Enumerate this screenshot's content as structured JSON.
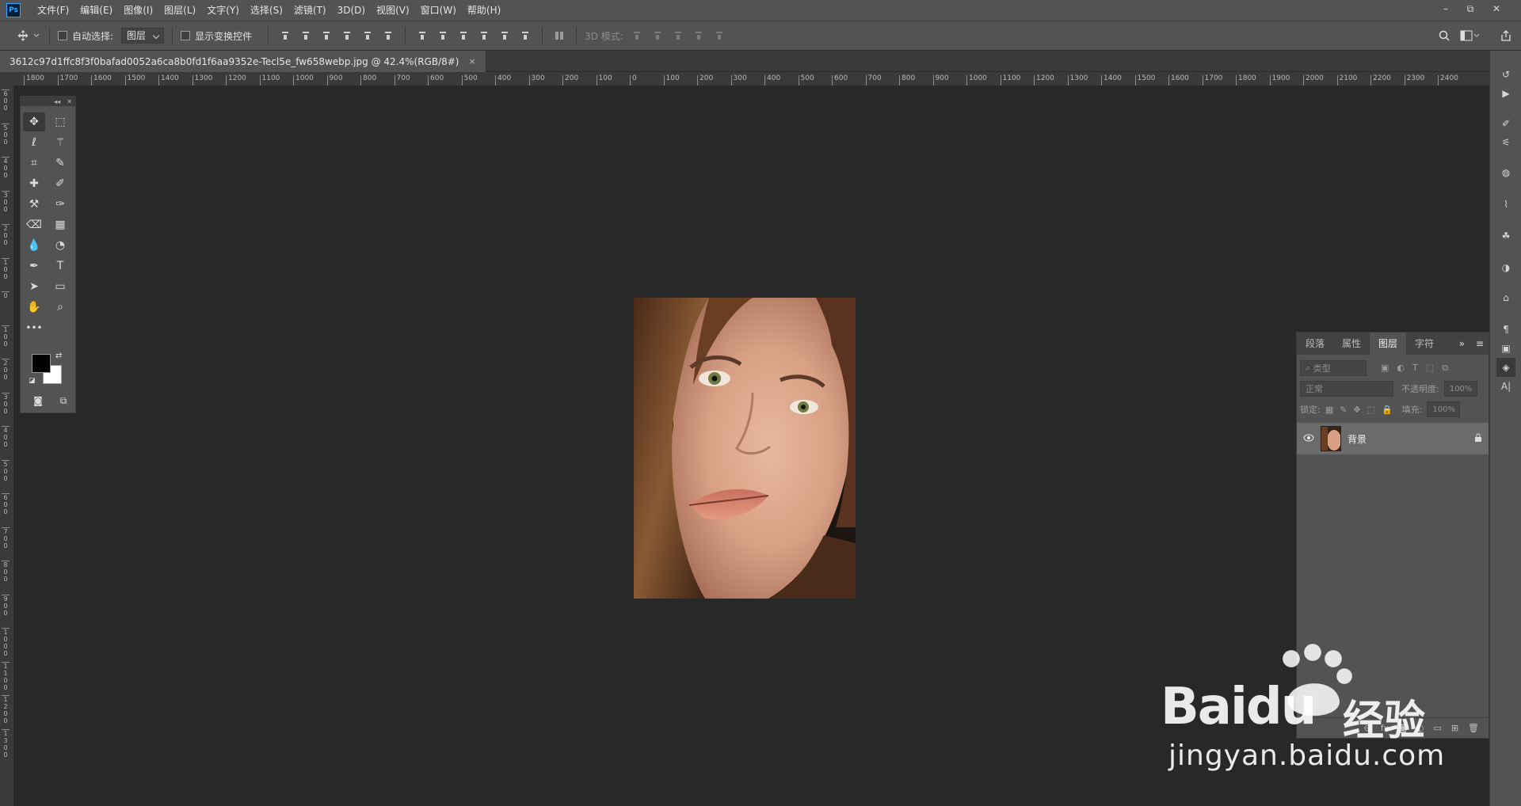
{
  "app": {
    "logo": "Ps"
  },
  "menu": [
    "文件(F)",
    "编辑(E)",
    "图像(I)",
    "图层(L)",
    "文字(Y)",
    "选择(S)",
    "滤镜(T)",
    "3D(D)",
    "视图(V)",
    "窗口(W)",
    "帮助(H)"
  ],
  "window_controls": {
    "minimize": "–",
    "restore": "⧉",
    "close": "✕"
  },
  "options": {
    "auto_select_label": "自动选择:",
    "auto_select_target": "图层",
    "show_transform_label": "显示变换控件",
    "mode_3d_label": "3D 模式:"
  },
  "document_tab": {
    "title": "3612c97d1ffc8f3f0bafad0052a6ca8b0fd1f6aa9352e-Tecl5e_fw658webp.jpg @ 42.4%(RGB/8#)",
    "close": "×"
  },
  "ruler": {
    "horizontal": [
      "1800",
      "1700",
      "1600",
      "1500",
      "1400",
      "1300",
      "1200",
      "1100",
      "1000",
      "900",
      "800",
      "700",
      "600",
      "500",
      "400",
      "300",
      "200",
      "100",
      "0",
      "100",
      "200",
      "300",
      "400",
      "500",
      "600",
      "700",
      "800",
      "900",
      "1000",
      "1100",
      "1200",
      "1300",
      "1400",
      "1500",
      "1600",
      "1700",
      "1800",
      "1900",
      "2000",
      "2100",
      "2200",
      "2300",
      "2400"
    ],
    "vertical": [
      "600",
      "500",
      "400",
      "300",
      "200",
      "100",
      "0",
      "100",
      "200",
      "300",
      "400",
      "500",
      "600",
      "700",
      "800",
      "900",
      "1000",
      "1100",
      "1200",
      "1300"
    ]
  },
  "layers_panel": {
    "tabs": [
      "段落",
      "属性",
      "图层",
      "字符"
    ],
    "active_tab": "图层",
    "filter_placeholder": "类型",
    "blend_mode": "正常",
    "opacity_label": "不透明度:",
    "opacity_value": "100%",
    "lock_label": "锁定:",
    "fill_label": "填充:",
    "fill_value": "100%",
    "layers": [
      {
        "name": "背景",
        "visible": true,
        "locked": true
      }
    ]
  },
  "watermark": {
    "brand": "Baidu",
    "product": "经验",
    "url": "jingyan.baidu.com"
  },
  "colors": {
    "foreground": "#000000",
    "background": "#ffffff",
    "ui_panel": "#535353",
    "canvas_bg": "#282828"
  }
}
